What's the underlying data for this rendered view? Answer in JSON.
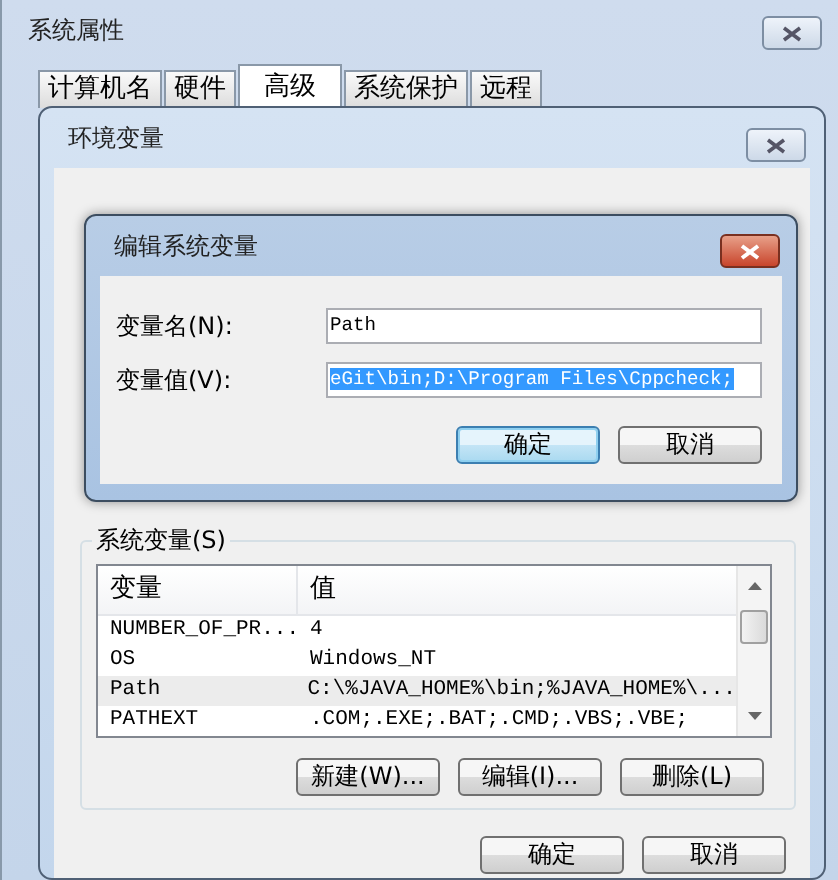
{
  "system_properties": {
    "title": "系统属性",
    "tabs": [
      {
        "label": "计算机名",
        "selected": false
      },
      {
        "label": "硬件",
        "selected": false
      },
      {
        "label": "高级",
        "selected": true
      },
      {
        "label": "系统保护",
        "selected": false
      },
      {
        "label": "远程",
        "selected": false
      }
    ]
  },
  "environment_variables": {
    "title": "环境变量",
    "system_variables": {
      "label": "系统变量(S)",
      "columns": [
        "变量",
        "值"
      ],
      "rows": [
        {
          "name": "NUMBER_OF_PR...",
          "value": "4",
          "selected": false
        },
        {
          "name": "OS",
          "value": "Windows_NT",
          "selected": false
        },
        {
          "name": "Path",
          "value": "C:\\%JAVA_HOME%\\bin;%JAVA_HOME%\\...",
          "selected": true
        },
        {
          "name": "PATHEXT",
          "value": ".COM;.EXE;.BAT;.CMD;.VBS;.VBE;",
          "selected": false
        }
      ],
      "buttons": [
        "新建(W)...",
        "编辑(I)...",
        "删除(L)"
      ]
    },
    "buttons": [
      "确定",
      "取消"
    ]
  },
  "edit_dialog": {
    "title": "编辑系统变量",
    "fields": [
      {
        "label": "变量名(N):",
        "value": "Path",
        "selected": false
      },
      {
        "label": "变量值(V):",
        "value": "eGit\\bin;D:\\Program Files\\Cppcheck;",
        "selected": true
      }
    ],
    "buttons": [
      {
        "label": "确定",
        "default": true
      },
      {
        "label": "取消",
        "default": false
      }
    ]
  }
}
